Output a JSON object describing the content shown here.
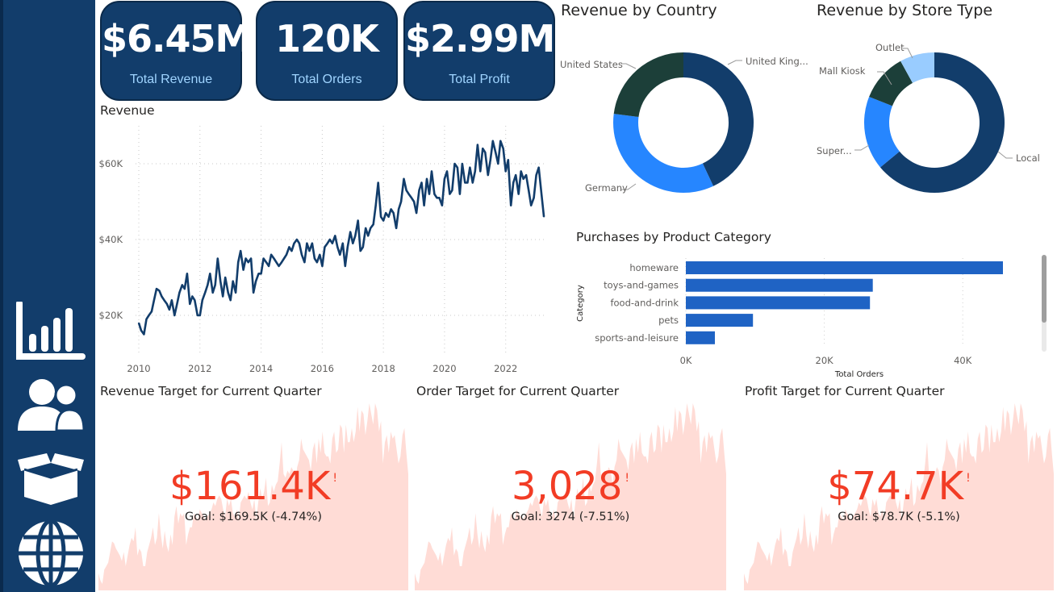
{
  "nav": [
    {
      "name": "chart-icon"
    },
    {
      "name": "customers-icon"
    },
    {
      "name": "product-box-icon"
    },
    {
      "name": "globe-icon"
    }
  ],
  "kpis": [
    {
      "value": "$6.45M",
      "label": "Total Revenue"
    },
    {
      "value": "120K",
      "label": "Total Orders"
    },
    {
      "value": "$2.99M",
      "label": "Total Profit"
    }
  ],
  "colors": {
    "navy": "#123d6b",
    "line": "#123d6b",
    "blue": "#2686ff",
    "darkgreen": "#1c3f39",
    "lightblue": "#99ccff",
    "bar": "#1f63c4",
    "red": "#f23c25",
    "area": "#ffdcd6"
  },
  "revenue_chart": {
    "title": "Revenue",
    "xticks": [
      "2010",
      "2012",
      "2014",
      "2016",
      "2018",
      "2020",
      "2022"
    ],
    "yticks": [
      "$20K",
      "$40K",
      "$60K"
    ]
  },
  "country_chart": {
    "title": "Revenue by Country",
    "labels": [
      "United King...",
      "Germany",
      "United States"
    ]
  },
  "store_chart": {
    "title": "Revenue by Store Type",
    "labels": [
      "Local",
      "Super...",
      "Mall Kiosk",
      "Outlet"
    ]
  },
  "category_chart": {
    "title": "Purchases by Product Category",
    "ylabel": "Category",
    "xlabel": "Total Orders",
    "xticks": [
      "0K",
      "20K",
      "40K"
    ]
  },
  "gauges": [
    {
      "title": "Revenue Target for Current Quarter",
      "value": "$161.4K",
      "bang": "!",
      "goal": "Goal: $169.5K (-4.74%)"
    },
    {
      "title": "Order Target for Current Quarter",
      "value": "3,028",
      "bang": "!",
      "goal": "Goal: 3274 (-7.51%)"
    },
    {
      "title": "Profit Target for Current Quarter",
      "value": "$74.7K",
      "bang": "!",
      "goal": "Goal: $78.7K (-5.1%)"
    }
  ],
  "chart_data": [
    {
      "type": "line",
      "title": "Revenue",
      "xlabel": "",
      "ylabel": "",
      "xlim": [
        2010,
        2023.3
      ],
      "ylim": [
        10000,
        70000
      ],
      "grid": true,
      "x": [
        2010.0,
        2010.08,
        2010.17,
        2010.25,
        2010.33,
        2010.42,
        2010.5,
        2010.58,
        2010.67,
        2010.75,
        2010.83,
        2010.92,
        2011.0,
        2011.08,
        2011.17,
        2011.25,
        2011.33,
        2011.42,
        2011.5,
        2011.58,
        2011.67,
        2011.75,
        2011.83,
        2011.92,
        2012.0,
        2012.08,
        2012.17,
        2012.25,
        2012.33,
        2012.42,
        2012.5,
        2012.58,
        2012.67,
        2012.75,
        2012.83,
        2012.92,
        2013.0,
        2013.08,
        2013.17,
        2013.25,
        2013.33,
        2013.42,
        2013.5,
        2013.58,
        2013.67,
        2013.75,
        2013.83,
        2013.92,
        2014.0,
        2014.08,
        2014.17,
        2014.25,
        2014.33,
        2014.42,
        2014.5,
        2014.58,
        2014.67,
        2014.75,
        2014.83,
        2014.92,
        2015.0,
        2015.08,
        2015.17,
        2015.25,
        2015.33,
        2015.42,
        2015.5,
        2015.58,
        2015.67,
        2015.75,
        2015.83,
        2015.92,
        2016.0,
        2016.08,
        2016.17,
        2016.25,
        2016.33,
        2016.42,
        2016.5,
        2016.58,
        2016.67,
        2016.75,
        2016.83,
        2016.92,
        2017.0,
        2017.08,
        2017.17,
        2017.25,
        2017.33,
        2017.42,
        2017.5,
        2017.58,
        2017.67,
        2017.75,
        2017.83,
        2017.92,
        2018.0,
        2018.08,
        2018.17,
        2018.25,
        2018.33,
        2018.42,
        2018.5,
        2018.58,
        2018.67,
        2018.75,
        2018.83,
        2018.92,
        2019.0,
        2019.08,
        2019.17,
        2019.25,
        2019.33,
        2019.42,
        2019.5,
        2019.58,
        2019.67,
        2019.75,
        2019.83,
        2019.92,
        2020.0,
        2020.08,
        2020.17,
        2020.25,
        2020.33,
        2020.42,
        2020.5,
        2020.58,
        2020.67,
        2020.75,
        2020.83,
        2020.92,
        2021.0,
        2021.08,
        2021.17,
        2021.25,
        2021.33,
        2021.42,
        2021.5,
        2021.58,
        2021.67,
        2021.75,
        2021.83,
        2021.92,
        2022.0,
        2022.08,
        2022.17,
        2022.25,
        2022.33,
        2022.42,
        2022.5,
        2022.58,
        2022.67,
        2022.75,
        2022.83,
        2022.92,
        2023.0,
        2023.08,
        2023.17,
        2023.25
      ],
      "y": [
        18000,
        16000,
        15000,
        19000,
        20000,
        21000,
        24000,
        27000,
        26500,
        25000,
        24000,
        23000,
        21500,
        24000,
        20000,
        23000,
        26000,
        28000,
        27000,
        31000,
        23000,
        25000,
        24000,
        20000,
        20000,
        24000,
        26000,
        28000,
        31000,
        26000,
        28000,
        35000,
        29000,
        25000,
        30000,
        26000,
        24000,
        29000,
        26000,
        34000,
        37000,
        32000,
        35000,
        34000,
        35000,
        26000,
        29000,
        31000,
        31000,
        35000,
        34000,
        33000,
        36000,
        35000,
        34000,
        33000,
        34000,
        35000,
        36000,
        38000,
        37000,
        39000,
        40000,
        39000,
        36000,
        34000,
        39000,
        37000,
        39000,
        35000,
        34000,
        36000,
        33000,
        38000,
        39000,
        40000,
        39000,
        41000,
        38000,
        36000,
        39000,
        33000,
        38000,
        42000,
        39000,
        41000,
        45000,
        37000,
        38000,
        43000,
        41000,
        43000,
        44000,
        49000,
        55000,
        46000,
        45000,
        47000,
        46000,
        48000,
        47000,
        43000,
        48000,
        50000,
        56000,
        53000,
        52000,
        51000,
        50000,
        47000,
        53000,
        55000,
        49000,
        56000,
        52000,
        58000,
        52000,
        51000,
        51000,
        49000,
        56000,
        58000,
        52000,
        53000,
        60000,
        59000,
        52000,
        60000,
        55000,
        55000,
        59000,
        55000,
        58000,
        65000,
        58000,
        64000,
        63000,
        57000,
        61000,
        66000,
        63000,
        60000,
        66000,
        64000,
        58000,
        61000,
        49000,
        55000,
        57000,
        52000,
        58000,
        56000,
        57000,
        53000,
        49000,
        51000,
        57000,
        59000,
        52000,
        46000
      ]
    },
    {
      "type": "pie",
      "title": "Revenue by Country",
      "labels": [
        "United Kingdom",
        "Germany",
        "United States"
      ],
      "values": [
        0.43,
        0.34,
        0.23
      ]
    },
    {
      "type": "pie",
      "title": "Revenue by Store Type",
      "labels": [
        "Local",
        "Super...",
        "Mall Kiosk",
        "Outlet"
      ],
      "values": [
        0.64,
        0.17,
        0.11,
        0.08
      ]
    },
    {
      "type": "bar",
      "title": "Purchases by Product Category",
      "ylabel": "Category",
      "xlabel": "Total Orders",
      "categories": [
        "homeware",
        "toys-and-games",
        "food-and-drink",
        "pets",
        "sports-and-leisure"
      ],
      "values": [
        45800,
        27000,
        26600,
        9700,
        4200
      ],
      "xlim": [
        0,
        50000
      ]
    },
    {
      "type": "area",
      "title": "Revenue Target for Current Quarter",
      "value": 161.4,
      "goal": 169.5
    },
    {
      "type": "area",
      "title": "Order Target for Current Quarter",
      "value": 3028,
      "goal": 3274
    },
    {
      "type": "area",
      "title": "Profit Target for Current Quarter",
      "value": 74.7,
      "goal": 78.7
    }
  ]
}
